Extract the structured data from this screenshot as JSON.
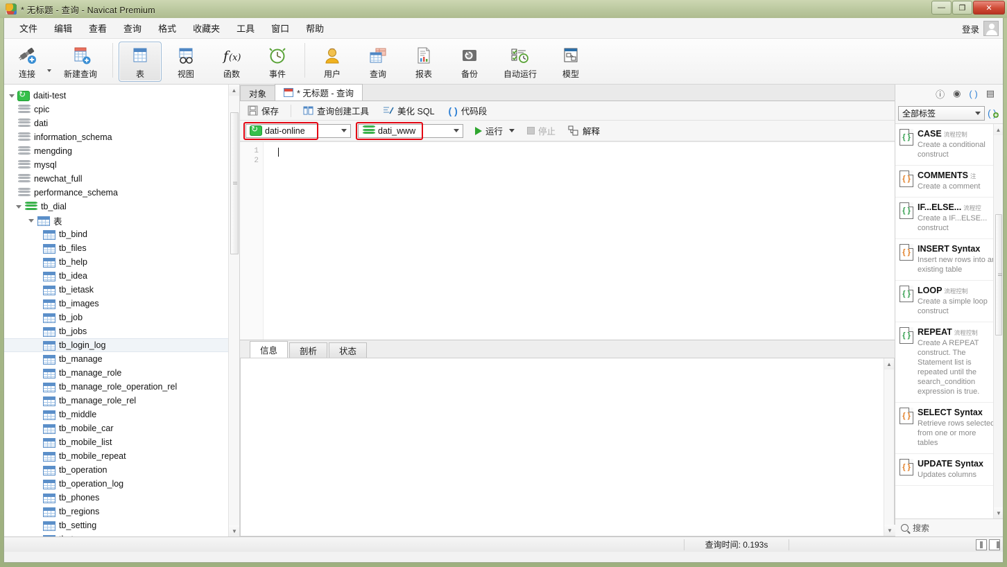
{
  "window": {
    "title": "* 无标题 - 查询 - Navicat Premium",
    "minimize": "―",
    "maximize": "❐",
    "close": "✕"
  },
  "menubar": {
    "items": [
      "文件",
      "编辑",
      "查看",
      "查询",
      "格式",
      "收藏夹",
      "工具",
      "窗口",
      "帮助"
    ],
    "login_label": "登录"
  },
  "ribbon": {
    "items": [
      {
        "label": "连接",
        "icon": "connection-icon"
      },
      {
        "label": "新建查询",
        "icon": "new-query-icon"
      },
      {
        "label": "表",
        "icon": "table-icon",
        "active": true
      },
      {
        "label": "视图",
        "icon": "view-icon"
      },
      {
        "label": "函数",
        "icon": "function-icon"
      },
      {
        "label": "事件",
        "icon": "event-icon"
      },
      {
        "label": "用户",
        "icon": "user-icon"
      },
      {
        "label": "查询",
        "icon": "query-icon"
      },
      {
        "label": "报表",
        "icon": "report-icon"
      },
      {
        "label": "备份",
        "icon": "backup-icon"
      },
      {
        "label": "自动运行",
        "icon": "automation-icon"
      },
      {
        "label": "模型",
        "icon": "model-icon"
      }
    ]
  },
  "sidebar": {
    "connection": "daiti-test",
    "databases": [
      "cpic",
      "dati",
      "information_schema",
      "mengding",
      "mysql",
      "newchat_full",
      "performance_schema"
    ],
    "open_database": "tb_dial",
    "tables_group": "表",
    "tables": [
      "tb_bind",
      "tb_files",
      "tb_help",
      "tb_idea",
      "tb_ietask",
      "tb_images",
      "tb_job",
      "tb_jobs",
      "tb_login_log",
      "tb_manage",
      "tb_manage_role",
      "tb_manage_role_operation_rel",
      "tb_manage_role_rel",
      "tb_middle",
      "tb_mobile_car",
      "tb_mobile_list",
      "tb_mobile_repeat",
      "tb_operation",
      "tb_operation_log",
      "tb_phones",
      "tb_regions",
      "tb_setting",
      "tb_tag"
    ],
    "selected_table": "tb_login_log"
  },
  "tabs": [
    {
      "label": "对象",
      "active": false
    },
    {
      "label": "* 无标题 - 查询",
      "active": true
    }
  ],
  "query_toolbar": {
    "save": "保存",
    "query_builder": "查询创建工具",
    "beautify_sql": "美化 SQL",
    "code_snippet": "代码段"
  },
  "connection_bar": {
    "connection_value": "dati-online",
    "database_value": "dati_www",
    "run": "运行",
    "stop": "停止",
    "explain": "解释"
  },
  "editor": {
    "line_numbers": [
      "1",
      "2"
    ],
    "content": ""
  },
  "result_tabs": [
    {
      "label": "信息",
      "active": true
    },
    {
      "label": "剖析",
      "active": false
    },
    {
      "label": "状态",
      "active": false
    }
  ],
  "right_panel": {
    "header_icons": [
      "info-icon",
      "target-icon",
      "code-snippet-icon",
      "structure-icon"
    ],
    "filter_value": "全部标签",
    "add_label": "()",
    "search_placeholder": "搜索",
    "snippets": [
      {
        "title": "CASE",
        "tag": "流程控制",
        "desc": "Create a conditional construct",
        "color": "g"
      },
      {
        "title": "COMMENTS",
        "tag": "注",
        "desc": "Create a comment",
        "color": "o"
      },
      {
        "title": "IF...ELSE...",
        "tag": "流程控",
        "desc": "Create a IF...ELSE... construct",
        "color": "g"
      },
      {
        "title": "INSERT Syntax",
        "tag": "",
        "desc": "Insert new rows into an existing table",
        "color": "o"
      },
      {
        "title": "LOOP",
        "tag": "流程控制",
        "desc": "Create a simple loop construct",
        "color": "g"
      },
      {
        "title": "REPEAT",
        "tag": "流程控制",
        "desc": "Create A REPEAT construct. The Statement list is repeated until the search_condition expression is true.",
        "color": "g"
      },
      {
        "title": "SELECT Syntax",
        "tag": "",
        "desc": "Retrieve rows selected from one or more tables",
        "color": "o"
      },
      {
        "title": "UPDATE Syntax",
        "tag": "",
        "desc": "Updates columns",
        "color": "o"
      }
    ]
  },
  "statusbar": {
    "query_time": "查询时间: 0.193s"
  },
  "colors": {
    "highlight_red": "#e30613",
    "accent_green": "#35c04a",
    "accent_blue": "#2d7fd4"
  }
}
